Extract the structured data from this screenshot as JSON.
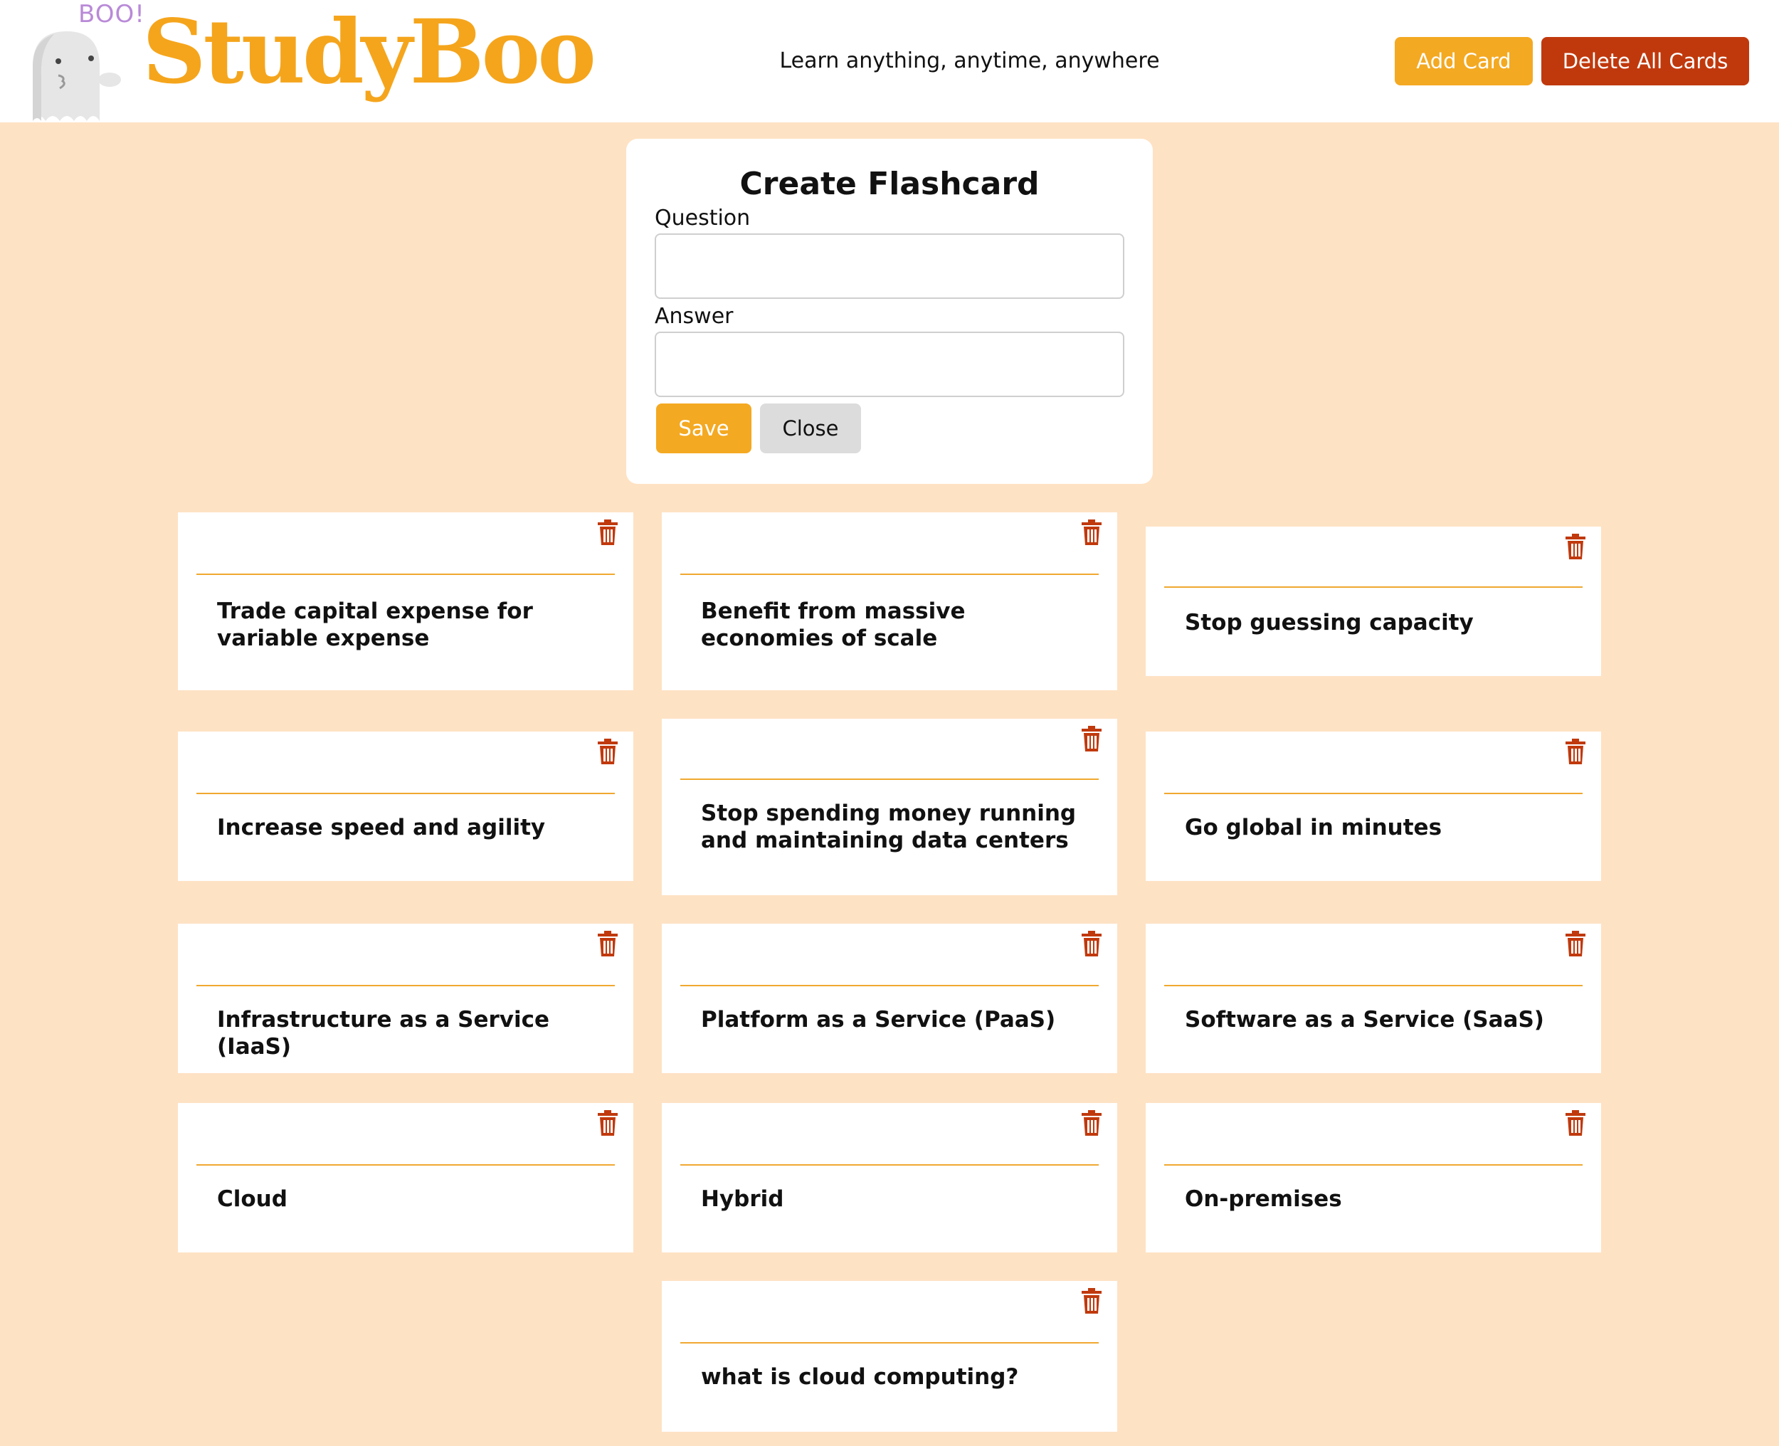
{
  "header": {
    "boo_label": "BOO!",
    "brand": "StudyBoo",
    "tagline": "Learn anything, anytime, anywhere",
    "add_card_label": "Add Card",
    "delete_all_label": "Delete All Cards"
  },
  "modal": {
    "title": "Create Flashcard",
    "question_label": "Question",
    "question_value": "",
    "answer_label": "Answer",
    "answer_value": "",
    "save_label": "Save",
    "close_label": "Close"
  },
  "cards": [
    {
      "question": "",
      "answer": "Trade capital expense for variable expense"
    },
    {
      "question": "",
      "answer": "Benefit from massive economies of scale"
    },
    {
      "question": "",
      "answer": "Stop guessing capacity"
    },
    {
      "question": "",
      "answer": "Increase speed and agility"
    },
    {
      "question": "",
      "answer": "Stop spending money running and maintaining data centers"
    },
    {
      "question": "",
      "answer": "Go global in minutes"
    },
    {
      "question": "",
      "answer": "Infrastructure as a Service (IaaS)"
    },
    {
      "question": "",
      "answer": "Platform as a Service (PaaS)"
    },
    {
      "question": "",
      "answer": "Software as a Service (SaaS)"
    },
    {
      "question": "",
      "answer": "Cloud"
    },
    {
      "question": "",
      "answer": "Hybrid"
    },
    {
      "question": "",
      "answer": "On-premises"
    },
    {
      "question": "",
      "answer": "what is cloud computing?"
    }
  ],
  "colors": {
    "background": "#fee2c4",
    "brand": "#f5a51c",
    "add_button": "#f4a922",
    "delete_button": "#c0390d",
    "trash_icon": "#c0390d",
    "card_rule": "#f0a830"
  },
  "icons": {
    "logo": "ghost-icon",
    "card_delete": "trash-icon"
  }
}
